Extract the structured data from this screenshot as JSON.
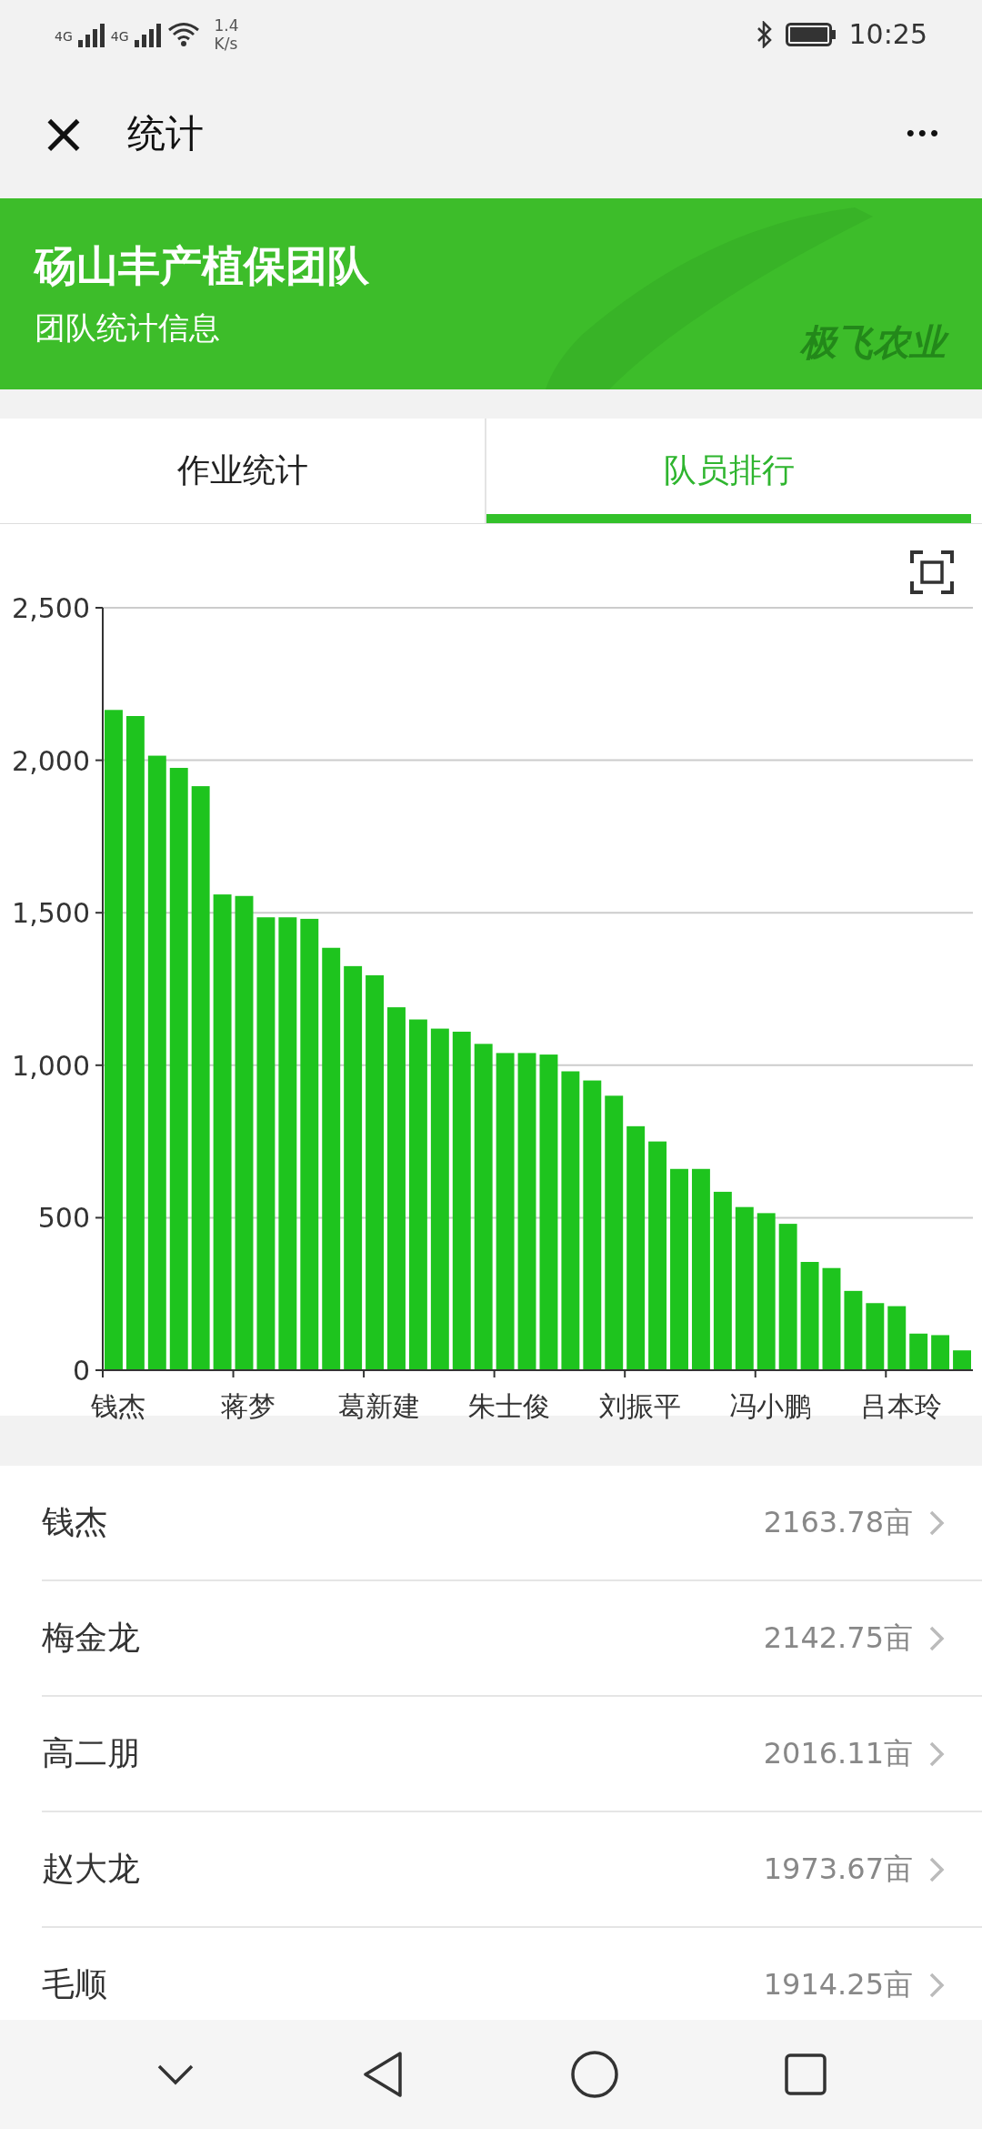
{
  "status_bar": {
    "network_1": "4G",
    "network_2": "4G",
    "speed_value": "1.4",
    "speed_unit": "K/s",
    "time": "10:25"
  },
  "nav": {
    "close": "×",
    "title": "统计",
    "more": "•••"
  },
  "banner": {
    "title": "砀山丰产植保团队",
    "subtitle": "团队统计信息",
    "brand": "极飞农业"
  },
  "tabs": [
    {
      "label": "作业统计",
      "selected": false
    },
    {
      "label": "队员排行",
      "selected": true
    }
  ],
  "chart": {
    "chart_data": {
      "type": "bar",
      "categories": [
        "钱杰",
        null,
        null,
        null,
        null,
        null,
        "蒋梦",
        null,
        null,
        null,
        null,
        null,
        "葛新建",
        null,
        null,
        null,
        null,
        null,
        "朱士俊",
        null,
        null,
        null,
        null,
        null,
        "刘振平",
        null,
        null,
        null,
        null,
        null,
        "冯小鹏",
        null,
        null,
        null,
        null,
        null,
        "吕本玲",
        null,
        null,
        null
      ],
      "values": [
        2165,
        2145,
        2015,
        1975,
        1915,
        1560,
        1555,
        1485,
        1485,
        1480,
        1385,
        1325,
        1295,
        1190,
        1150,
        1120,
        1110,
        1070,
        1040,
        1040,
        1035,
        980,
        950,
        900,
        800,
        750,
        660,
        660,
        585,
        535,
        515,
        480,
        355,
        335,
        260,
        220,
        210,
        120,
        115,
        65
      ],
      "color": "#1ec41e",
      "grid": true,
      "ylim": [
        0,
        2500
      ],
      "yticks": [
        {
          "value": 0,
          "label": "0"
        },
        {
          "value": 500,
          "label": "500"
        },
        {
          "value": 1000,
          "label": "1,000"
        },
        {
          "value": 1500,
          "label": "1,500"
        },
        {
          "value": 2000,
          "label": "2,000"
        },
        {
          "value": 2500,
          "label": "2,500"
        }
      ]
    }
  },
  "ranking": [
    {
      "name": "钱杰",
      "area": "2163.78亩"
    },
    {
      "name": "梅金龙",
      "area": "2142.75亩"
    },
    {
      "name": "高二朋",
      "area": "2016.11亩"
    },
    {
      "name": "赵大龙",
      "area": "1973.67亩"
    },
    {
      "name": "毛顺",
      "area": "1914.25亩"
    }
  ]
}
